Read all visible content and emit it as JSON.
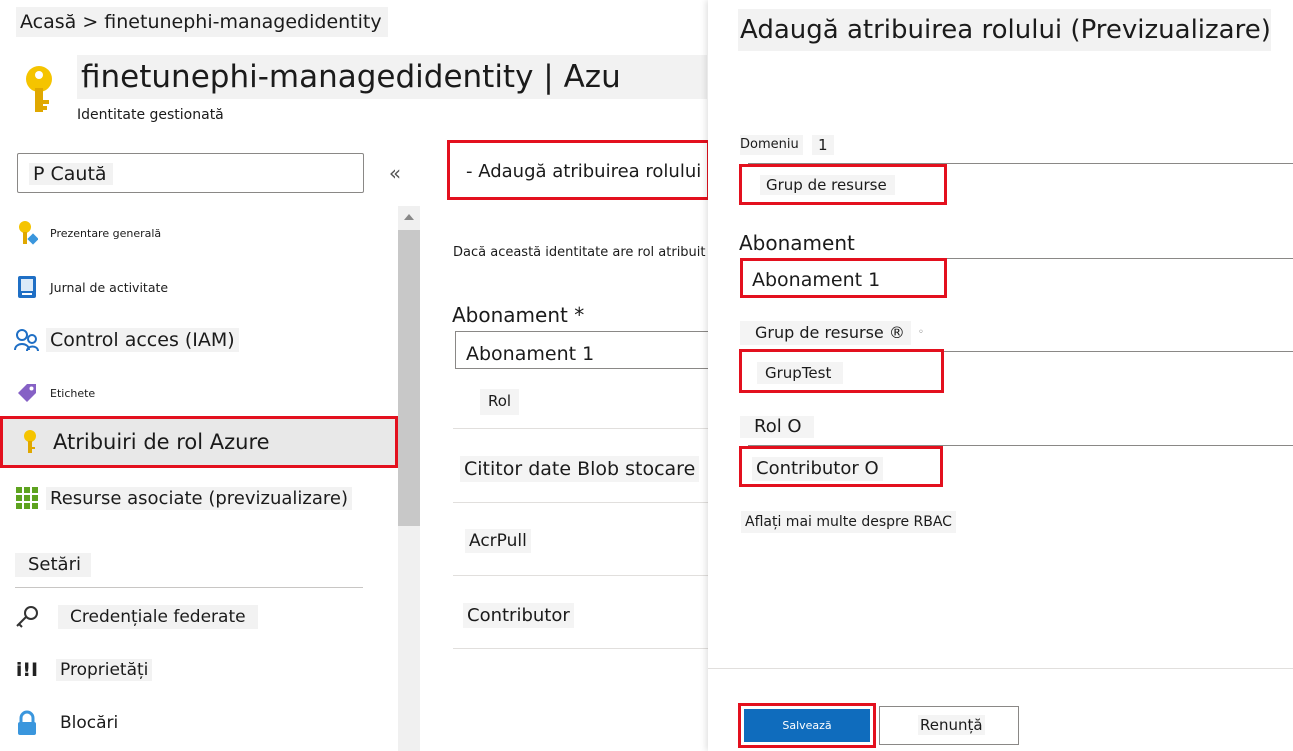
{
  "breadcrumb": "Acasă > finetunephi-managedidentity",
  "header": {
    "title": "finetunephi-managedidentity | Azu",
    "subtitle": "Identitate gestionată"
  },
  "sidebar": {
    "search_placeholder": "P Caută",
    "collapse_glyph": "«",
    "items": [
      {
        "label": "Prezentare generală"
      },
      {
        "label": "Jurnal de activitate"
      },
      {
        "label": "Control acces (IAM)"
      },
      {
        "label": "Etichete"
      },
      {
        "label": "Atribuiri de rol Azure"
      },
      {
        "label": "Resurse asociate (previzualizare)"
      }
    ],
    "settings_heading": "Setări",
    "settings_items": [
      {
        "label": "Credențiale federate"
      },
      {
        "label": "Proprietăți"
      },
      {
        "label": "Blocări"
      }
    ]
  },
  "middle": {
    "add_button_label": "- Adaugă atribuirea rolului",
    "description": "Dacă această identitate are rol atribuit",
    "subscription_label": "Abonament *",
    "subscription_value": "Abonament 1",
    "role_column_header": "Rol",
    "rows": [
      "Cititor date Blob stocare",
      "AcrPull",
      "Contributor"
    ]
  },
  "panel": {
    "title": "Adaugă atribuirea rolului (Previzualizare)",
    "scope_label": "Domeniu",
    "scope_badge": "1",
    "scope_value": "Grup de resurse",
    "subscription_label": "Abonament",
    "subscription_value": "Abonament 1",
    "resource_group_label": "Grup de resurse ®",
    "resource_group_value": "GrupTest",
    "role_label": "Rol O",
    "role_value": "Contributor O",
    "rbac_link": "Aflați mai multe despre RBAC",
    "save_label": "Salvează",
    "cancel_label": "Renunță"
  },
  "colors": {
    "highlight_red": "#e3101e",
    "primary_blue": "#0f6cbd",
    "key_yellow": "#f5c400"
  },
  "icons": [
    "key-icon",
    "overview-icon",
    "activity-log-icon",
    "iam-icon",
    "tag-icon",
    "grid-icon",
    "federated-key-icon",
    "properties-icon",
    "lock-icon",
    "collapse-icon"
  ]
}
